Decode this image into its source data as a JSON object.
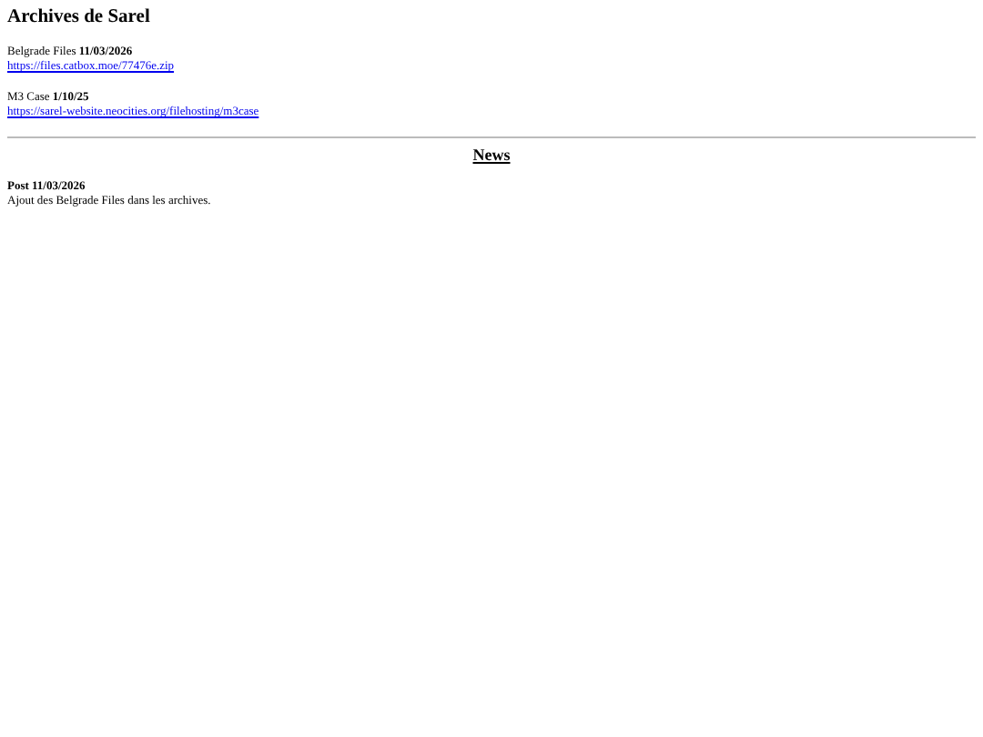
{
  "title": "Archives de Sarel",
  "archives": [
    {
      "label": "Belgrade Files **11/03/2026**",
      "link": "https://files.catbox.moe/77476e.zip"
    },
    {
      "label": "M3 Case **1/10/25**",
      "link": "https://sarel-website.neocities.org/filehosting/m3case"
    }
  ],
  "news": {
    "heading": "News",
    "posts": [
      {
        "title": "Post 11/03/2026",
        "body": "Ajout des Belgrade Files dans les archives."
      }
    ]
  }
}
